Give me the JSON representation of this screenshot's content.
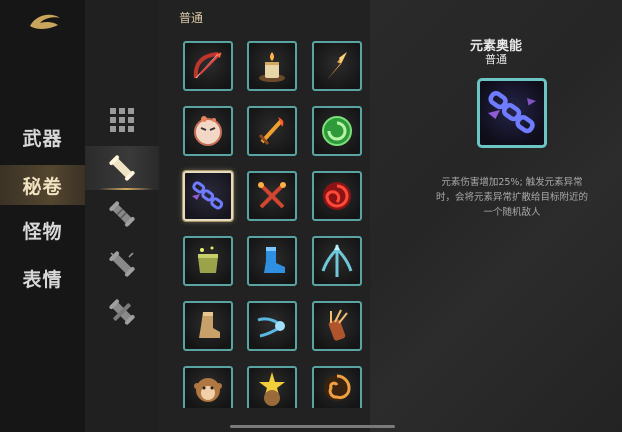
{
  "nav": {
    "items": [
      {
        "label": "武器",
        "active": false
      },
      {
        "label": "秘卷",
        "active": true
      },
      {
        "label": "怪物",
        "active": false
      },
      {
        "label": "表情",
        "active": false
      }
    ]
  },
  "sub": {
    "items": [
      {
        "icon": "grid-icon",
        "active": false
      },
      {
        "icon": "scroll-icon",
        "active": true
      },
      {
        "icon": "scroll-stacked-icon",
        "active": false
      },
      {
        "icon": "scroll-spark-icon",
        "active": false
      },
      {
        "icon": "scroll-cross-icon",
        "active": false
      }
    ]
  },
  "grid": {
    "section_title": "普通",
    "selected": "element-chain-icon",
    "items": [
      "red-bow-icon",
      "candle-icon",
      "golden-arrowhead-icon",
      "angry-bun-icon",
      "fire-sword-icon",
      "green-swirl-orb-icon",
      "element-chain-icon",
      "crossed-fire-sticks-icon",
      "red-spiral-orb-icon",
      "green-pouch-icon",
      "blue-boot-icon",
      "trident-arrow-icon",
      "leather-boot-icon",
      "comet-dash-icon",
      "arrow-quiver-icon",
      "monkey-face-icon",
      "star-burst-bear-icon",
      "vortex-icon"
    ]
  },
  "detail": {
    "name": "元素奥能",
    "rarity": "普通",
    "icon": "element-chain-icon",
    "description": "元素伤害增加25%; 触发元素异常时，会将元素异常扩散给目标附近的一个随机敌人"
  },
  "colors": {
    "cell_border": "#5aa3a3",
    "accent_gold": "#d3a861",
    "detail_border": "#6cc4c4"
  }
}
